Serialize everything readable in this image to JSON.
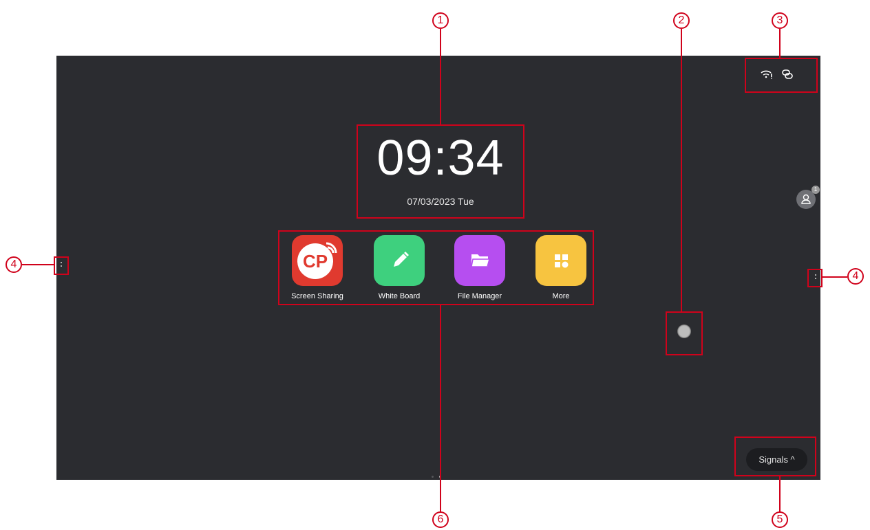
{
  "clock": {
    "time": "09:34",
    "date": "07/03/2023 Tue"
  },
  "apps": [
    {
      "label": "Screen Sharing",
      "icon": "cp-screen-share-icon",
      "color": "#e03a2f",
      "glyph": "CP"
    },
    {
      "label": "White Board",
      "icon": "pencil-icon",
      "color": "#3ed07e"
    },
    {
      "label": "File Manager",
      "icon": "folder-icon",
      "color": "#b64ef0"
    },
    {
      "label": "More",
      "icon": "grid-icon",
      "color": "#f7c440"
    }
  ],
  "status_bar": {
    "icons": [
      "wifi-icon",
      "link-icon"
    ]
  },
  "signals_button": {
    "label": "Signals ^"
  },
  "user": {
    "badge_count": "1"
  },
  "callouts": {
    "n1": "1",
    "n2": "2",
    "n3": "3",
    "n4": "4",
    "n5": "5",
    "n6": "6"
  },
  "colors": {
    "screen_bg": "#2b2c30",
    "callout": "#d0021b"
  }
}
